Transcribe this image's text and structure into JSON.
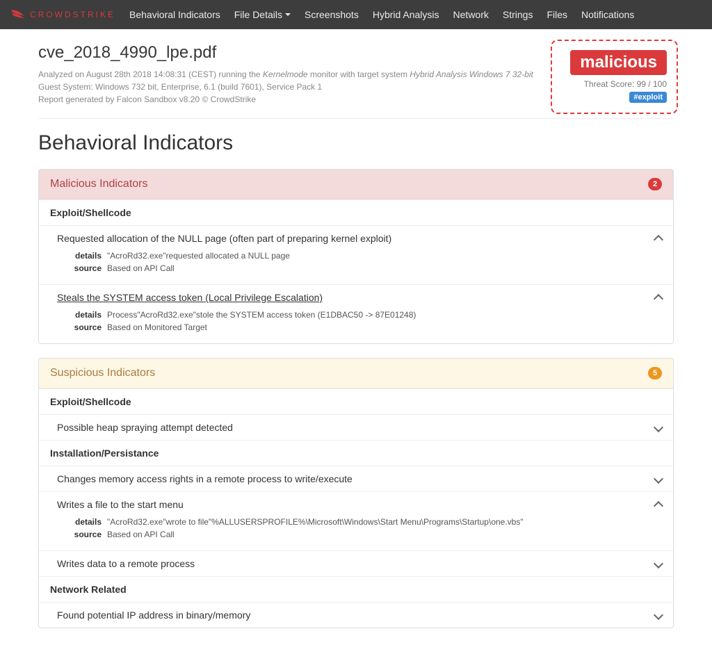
{
  "brand": "CROWDSTRIKE",
  "nav": [
    "Behavioral Indicators",
    "File Details",
    "Screenshots",
    "Hybrid Analysis",
    "Network",
    "Strings",
    "Files",
    "Notifications"
  ],
  "file": {
    "name": "cve_2018_4990_lpe.pdf",
    "analyzed_prefix": "Analyzed on August 28th 2018 14:08:31 (CEST) running the ",
    "analyzed_mode": "Kernelmode",
    "analyzed_mid": " monitor with target system ",
    "analyzed_target": "Hybrid Analysis Windows 7 32-bit",
    "guest": "Guest System: Windows 732 bit, Enterprise, 6.1 (build 7601), Service Pack 1",
    "report": "Report generated by Falcon Sandbox v8.20 © CrowdStrike"
  },
  "verdict": {
    "label": "malicious",
    "score": "Threat Score: 99 / 100",
    "tag": "#exploit"
  },
  "section_title": "Behavioral Indicators",
  "labels": {
    "details": "details",
    "source": "source"
  },
  "malicious": {
    "title": "Malicious Indicators",
    "count": "2",
    "groups": [
      {
        "name": "Exploit/Shellcode",
        "items": [
          {
            "title": "Requested allocation of the NULL page (often part of preparing kernel exploit)",
            "expanded": true,
            "details": "\"AcroRd32.exe\"requested allocated a NULL page",
            "source": "Based on API Call"
          },
          {
            "title": "Steals the SYSTEM access token (Local Privilege Escalation)",
            "underlined": true,
            "expanded": true,
            "details": "Process\"AcroRd32.exe\"stole the SYSTEM access token (E1DBAC50 -> 87E01248)",
            "source": "Based on Monitored Target"
          }
        ]
      }
    ]
  },
  "suspicious": {
    "title": "Suspicious Indicators",
    "count": "5",
    "groups": [
      {
        "name": "Exploit/Shellcode",
        "items": [
          {
            "title": "Possible heap spraying attempt detected",
            "expanded": false
          }
        ]
      },
      {
        "name": "Installation/Persistance",
        "items": [
          {
            "title": "Changes memory access rights in a remote process to write/execute",
            "expanded": false
          },
          {
            "title": "Writes a file to the start menu",
            "expanded": true,
            "details": "\"AcroRd32.exe\"wrote to file\"%ALLUSERSPROFILE%\\Microsoft\\Windows\\Start Menu\\Programs\\Startup\\one.vbs\"",
            "source": "Based on API Call"
          },
          {
            "title": "Writes data to a remote process",
            "expanded": false
          }
        ]
      },
      {
        "name": "Network Related",
        "items": [
          {
            "title": "Found potential IP address in binary/memory",
            "expanded": false
          }
        ]
      }
    ]
  }
}
